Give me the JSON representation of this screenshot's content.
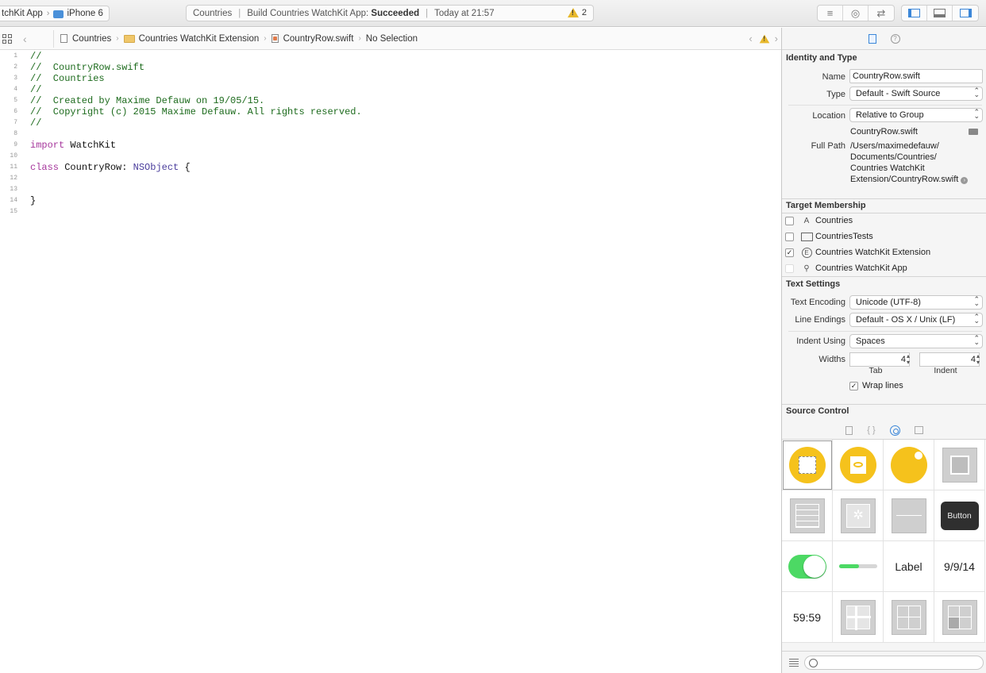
{
  "toolbar": {
    "scheme_name": "tchKit App",
    "device": "iPhone 6",
    "activity": {
      "project": "Countries",
      "status_prefix": "Build Countries WatchKit App:",
      "status_result": "Succeeded",
      "time": "Today at 21:57",
      "warning_count": "2"
    }
  },
  "jumpbar": {
    "crumbs": [
      "Countries",
      "Countries WatchKit Extension",
      "CountryRow.swift",
      "No Selection"
    ]
  },
  "editor": {
    "lines": [
      {
        "n": "1",
        "text": "//"
      },
      {
        "n": "2",
        "text": "//  CountryRow.swift"
      },
      {
        "n": "3",
        "text": "//  Countries"
      },
      {
        "n": "4",
        "text": "//"
      },
      {
        "n": "5",
        "text": "//  Created by Maxime Defauw on 19/05/15."
      },
      {
        "n": "6",
        "text": "//  Copyright (c) 2015 Maxime Defauw. All rights reserved."
      },
      {
        "n": "7",
        "text": "//"
      },
      {
        "n": "8",
        "text": ""
      },
      {
        "n": "9",
        "kw": "import",
        "rest": " WatchKit"
      },
      {
        "n": "10",
        "text": ""
      },
      {
        "n": "11",
        "kw": "class",
        "mid": " CountryRow: ",
        "type": "NSObject",
        "rest": " {"
      },
      {
        "n": "12",
        "text": ""
      },
      {
        "n": "13",
        "text": ""
      },
      {
        "n": "14",
        "plain": "}"
      },
      {
        "n": "15",
        "text": ""
      }
    ]
  },
  "inspector": {
    "identity": {
      "title": "Identity and Type",
      "name_label": "Name",
      "name_value": "CountryRow.swift",
      "type_label": "Type",
      "type_value": "Default - Swift Source",
      "location_label": "Location",
      "location_value": "Relative to Group",
      "location_file": "CountryRow.swift",
      "fullpath_label": "Full Path",
      "fullpath_lines": [
        "/Users/maximedefauw/",
        "Documents/Countries/",
        "Countries WatchKit",
        "Extension/CountryRow.swift"
      ]
    },
    "target": {
      "title": "Target Membership",
      "items": [
        {
          "label": "Countries",
          "checked": false,
          "icon": "app-icon"
        },
        {
          "label": "CountriesTests",
          "checked": false,
          "icon": "folder-icon"
        },
        {
          "label": "Countries WatchKit Extension",
          "checked": true,
          "icon": "extension-icon"
        },
        {
          "label": "Countries WatchKit App",
          "checked": false,
          "icon": "watch-app-icon"
        }
      ]
    },
    "text": {
      "title": "Text Settings",
      "encoding_label": "Text Encoding",
      "encoding_value": "Unicode (UTF-8)",
      "endings_label": "Line Endings",
      "endings_value": "Default - OS X / Unix (LF)",
      "indent_label": "Indent Using",
      "indent_value": "Spaces",
      "widths_label": "Widths",
      "tab_value": "4",
      "indent_width_value": "4",
      "tab_sublabel": "Tab",
      "indent_sublabel": "Indent",
      "wrap_label": "Wrap lines",
      "wrap_checked": true
    },
    "source_control": {
      "title": "Source Control"
    },
    "library": {
      "button_label": "Button",
      "label_label": "Label",
      "date_label": "9/9/14",
      "timer_label": "59:59"
    }
  }
}
